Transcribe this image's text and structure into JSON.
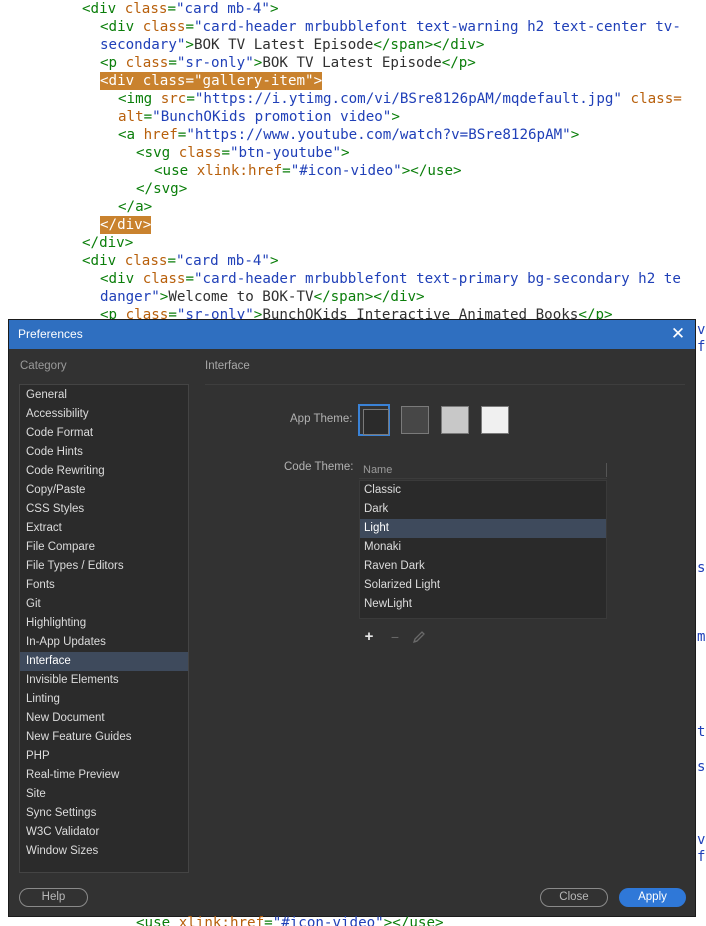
{
  "editor": {
    "lines": [
      {
        "parts": [
          [
            "tag",
            "<div "
          ],
          [
            "an",
            "class"
          ],
          [
            "tag",
            "="
          ],
          [
            "av",
            "\"card mb-4\""
          ],
          [
            "tag",
            ">"
          ]
        ]
      },
      {
        "parts": [
          [
            "tag",
            "<div "
          ],
          [
            "an",
            "class"
          ],
          [
            "tag",
            "="
          ],
          [
            "av",
            "\"card-header mrbubblefont text-warning h2 text-center tv-"
          ]
        ]
      },
      {
        "parts": [
          [
            "av",
            "secondary\""
          ],
          [
            "tag",
            ">"
          ],
          [
            "tx",
            "BOK TV Latest Episode"
          ],
          [
            "tag",
            "</span></div>"
          ]
        ]
      },
      {
        "parts": [
          [
            "tag",
            "<p "
          ],
          [
            "an",
            "class"
          ],
          [
            "tag",
            "="
          ],
          [
            "av",
            "\"sr-only\""
          ],
          [
            "tag",
            ">"
          ],
          [
            "tx",
            "BOK TV Latest Episode"
          ],
          [
            "tag",
            "</p>"
          ]
        ]
      },
      {
        "parts": [
          [
            "tag",
            "<div "
          ],
          [
            "an",
            "class"
          ],
          [
            "tag",
            "="
          ],
          [
            "av",
            "\"gallery-item\""
          ],
          [
            "tag",
            ">"
          ]
        ]
      },
      {
        "parts": [
          [
            "tag",
            "<img "
          ],
          [
            "an",
            "src"
          ],
          [
            "tag",
            "="
          ],
          [
            "av",
            "\"https://i.ytimg.com/vi/BSre8126pAM/mqdefault.jpg\""
          ],
          [
            "tx",
            " "
          ],
          [
            "an",
            "class="
          ]
        ]
      },
      {
        "parts": [
          [
            "an",
            "alt"
          ],
          [
            "tag",
            "="
          ],
          [
            "av",
            "\"BunchOKids promotion video\""
          ],
          [
            "tag",
            ">"
          ]
        ]
      },
      {
        "parts": [
          [
            "tag",
            "<a "
          ],
          [
            "an",
            "href"
          ],
          [
            "tag",
            "="
          ],
          [
            "av",
            "\"https://www.youtube.com/watch?v=BSre8126pAM\""
          ],
          [
            "tag",
            ">"
          ]
        ]
      },
      {
        "parts": [
          [
            "tag",
            "<svg "
          ],
          [
            "an",
            "class"
          ],
          [
            "tag",
            "="
          ],
          [
            "av",
            "\"btn-youtube\""
          ],
          [
            "tag",
            ">"
          ]
        ]
      },
      {
        "parts": [
          [
            "tag",
            "<use "
          ],
          [
            "an",
            "xlink:href"
          ],
          [
            "tag",
            "="
          ],
          [
            "av",
            "\"#icon-video\""
          ],
          [
            "tag",
            "></use>"
          ]
        ]
      },
      {
        "parts": [
          [
            "tag",
            "</svg>"
          ]
        ]
      },
      {
        "parts": [
          [
            "tag",
            "</a>"
          ]
        ]
      },
      {
        "parts": [
          [
            "tag",
            "</div>"
          ]
        ]
      },
      {
        "parts": [
          [
            "tag",
            "</div>"
          ]
        ]
      },
      {
        "parts": [
          [
            "tag",
            "<div "
          ],
          [
            "an",
            "class"
          ],
          [
            "tag",
            "="
          ],
          [
            "av",
            "\"card mb-4\""
          ],
          [
            "tag",
            ">"
          ]
        ]
      },
      {
        "parts": [
          [
            "tag",
            "<div "
          ],
          [
            "an",
            "class"
          ],
          [
            "tag",
            "="
          ],
          [
            "av",
            "\"card-header mrbubblefont text-primary bg-secondary h2 te"
          ]
        ]
      },
      {
        "parts": [
          [
            "av",
            "danger\""
          ],
          [
            "tag",
            ">"
          ],
          [
            "tx",
            "Welcome to BOK-TV"
          ],
          [
            "tag",
            "</span></div>"
          ]
        ]
      },
      {
        "parts": [
          [
            "tag",
            "<p "
          ],
          [
            "an",
            "class"
          ],
          [
            "tag",
            "="
          ],
          [
            "av",
            "\"sr-only\""
          ],
          [
            "tag",
            ">"
          ],
          [
            "tx",
            "BunchOKids Interactive Animated Books"
          ],
          [
            "tag",
            "</p>"
          ]
        ]
      }
    ],
    "right_edge_fragments": [
      "v=",
      "f",
      "sp",
      "m",
      "te",
      "s",
      "v=",
      "f"
    ],
    "bottom_fragment": [
      [
        "tag",
        "<use "
      ],
      [
        "an",
        "xlink:href"
      ],
      [
        "tag",
        "="
      ],
      [
        "av",
        "\"#icon-video\""
      ],
      [
        "tag",
        "></use>"
      ]
    ]
  },
  "dialog": {
    "title": "Preferences",
    "close_glyph": "✕",
    "category_label": "Category",
    "section_label": "Interface",
    "categories": [
      "General",
      "Accessibility",
      "Code Format",
      "Code Hints",
      "Code Rewriting",
      "Copy/Paste",
      "CSS Styles",
      "Extract",
      "File Compare",
      "File Types / Editors",
      "Fonts",
      "Git",
      "Highlighting",
      "In-App Updates",
      "Interface",
      "Invisible Elements",
      "Linting",
      "New Document",
      "New Feature Guides",
      "PHP",
      "Real-time Preview",
      "Site",
      "Sync Settings",
      "W3C Validator",
      "Window Sizes"
    ],
    "selected_category": "Interface",
    "app_theme": {
      "label": "App Theme:",
      "swatches": [
        "#2b2b2b",
        "#474747",
        "#c8c8c8",
        "#f0f0f0"
      ],
      "selected_index": 0
    },
    "code_theme": {
      "label": "Code Theme:",
      "column_header": "Name",
      "themes": [
        "Classic",
        "Dark",
        "Light",
        "Monaki",
        "Raven Dark",
        "Solarized Light",
        "NewLight"
      ],
      "selected": "Light"
    },
    "toolbar": {
      "add": "+",
      "remove": "−"
    },
    "buttons": {
      "help": "Help",
      "close": "Close",
      "apply": "Apply"
    }
  }
}
